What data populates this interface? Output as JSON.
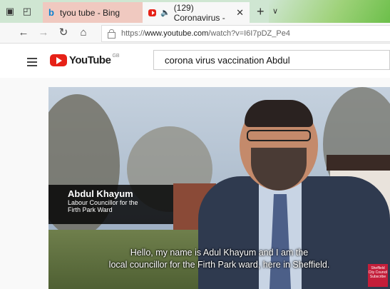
{
  "browser": {
    "tabs": [
      {
        "title": "tyou tube - Bing",
        "favicon": "bing-icon"
      },
      {
        "title": "(129) Coronavirus -",
        "favicon": "youtube-icon",
        "audio": "speaker-icon"
      }
    ],
    "new_tab_glyph": "+",
    "tab_list_glyph": "∨",
    "address": {
      "prefix": "https://",
      "host": "www.youtube.com",
      "path": "/watch?v=I6I7pDZ_Pe4"
    }
  },
  "youtube": {
    "logo_text": "YouTube",
    "country_code": "GB",
    "search_value": "corona virus vaccination Abdul"
  },
  "video": {
    "lower_third": {
      "name": "Abdul Khayum",
      "role_line1": "Labour Councillor for the",
      "role_line2": "Firth Park Ward"
    },
    "caption_line1": "Hello, my name is Adul Khayum and I am the",
    "caption_line2": "local councillor for the Firth Park ward, here in Sheffield.",
    "badge_text": "Sheffield City Council Subscribe"
  },
  "colors": {
    "youtube_red": "#e62117",
    "tab_active": "#f7f7f7",
    "tab_inactive": "#f0c9c0"
  }
}
